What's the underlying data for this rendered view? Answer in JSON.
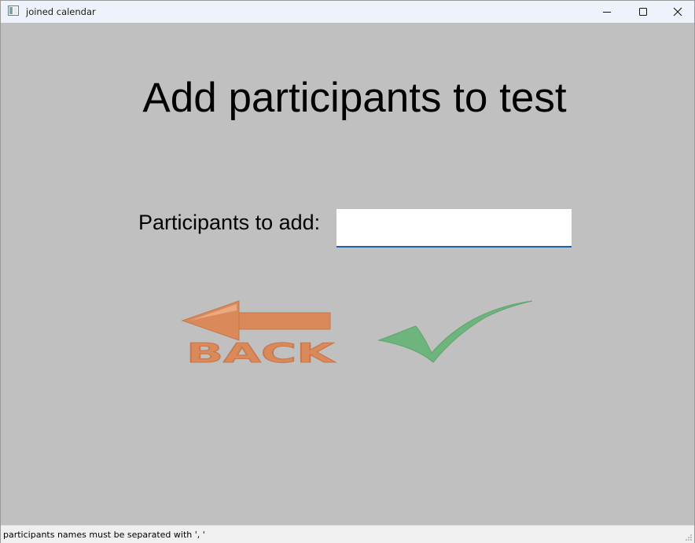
{
  "window": {
    "title": "joined calendar",
    "icon": "app-window-icon",
    "controls": [
      "minimize-icon",
      "maximize-icon",
      "close-icon"
    ]
  },
  "main": {
    "heading": "Add participants to test",
    "participants_label": "Participants to add:",
    "participants_value": "",
    "back_button": {
      "label": "BACK",
      "icon": "back-arrow-icon",
      "color": "#d9895a"
    },
    "confirm_button": {
      "icon": "checkmark-icon",
      "color": "#6db57c"
    }
  },
  "statusbar": {
    "message": "participants names must be separated with ', '"
  },
  "colors": {
    "background": "#c0c0c0",
    "titlebar": "#eef3fb",
    "input_underline": "#1e5fa8"
  }
}
